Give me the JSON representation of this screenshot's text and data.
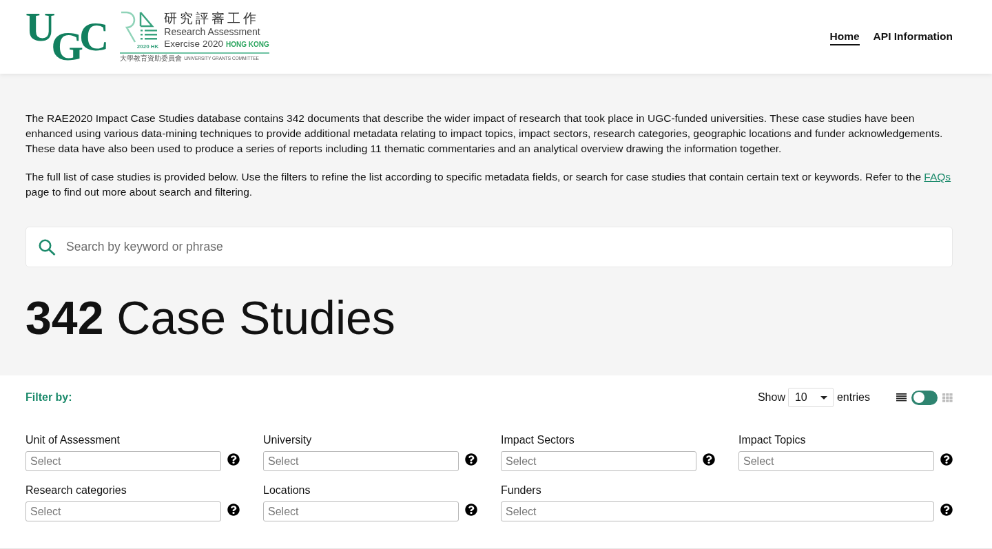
{
  "header": {
    "logo": {
      "ugc": "UGC",
      "mark_caption": "2020 HK",
      "title_zh": "研究評審工作",
      "title_en_line1": "Research Assessment",
      "title_en_line2": "Exercise 2020",
      "title_highlight": "HONG KONG",
      "committee_zh": "大學教育資助委員會",
      "committee_en": "UNIVERSITY GRANTS COMMITTEE"
    },
    "nav": [
      {
        "label": "Home",
        "selected": true
      },
      {
        "label": "API Information",
        "selected": false
      }
    ]
  },
  "intro": {
    "paragraphs": [
      {
        "segments": [
          {
            "kind": "text",
            "text": "The RAE2020 Impact Case Studies database contains 342 documents that describe the wider impact of research that took place in UGC-funded universities. These case studies have been enhanced using various data-mining techniques to provide additional metadata relating to impact topics, impact sectors, research categories, geographic locations and funder acknowledgements. These data have also been used to produce a series of reports including 11 thematic commentaries and an analytical overview drawing the information together."
          }
        ]
      },
      {
        "segments": [
          {
            "kind": "text",
            "text": "The full list of case studies is provided below. Use the filters to refine the list according to specific metadata fields, or search for case studies that contain certain text or keywords. Refer to the "
          },
          {
            "kind": "link",
            "text": "FAQs"
          },
          {
            "kind": "text",
            "text": " page to find out more about search and filtering."
          }
        ]
      }
    ]
  },
  "search": {
    "placeholder": "Search by keyword or phrase"
  },
  "heading": {
    "text": "**342** Case Studies"
  },
  "filter_bar": {
    "label": "Filter by:",
    "show_label": "Show",
    "entries_select": {
      "value": "10"
    },
    "entries_label": "entries",
    "view_toggle": {
      "grid_view": false
    }
  },
  "filters": [
    {
      "label": "Unit of Assessment",
      "placeholder": "Select",
      "kind": "normal"
    },
    {
      "label": "University",
      "placeholder": "Select",
      "kind": "normal"
    },
    {
      "label": "Impact Sectors",
      "placeholder": "Select",
      "kind": "normal"
    },
    {
      "label": "Impact Topics",
      "placeholder": "Select",
      "kind": "normal"
    },
    {
      "label": "Research categories",
      "placeholder": "Select",
      "kind": "normal"
    },
    {
      "label": "Locations",
      "placeholder": "Select",
      "kind": "normal"
    },
    {
      "label": "Funders",
      "placeholder": "Select",
      "kind": "wide"
    }
  ]
}
